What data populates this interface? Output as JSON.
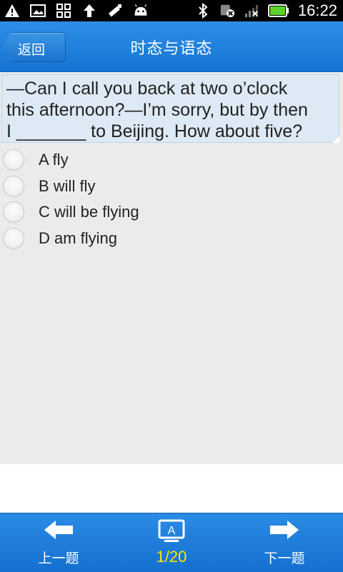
{
  "statusbar": {
    "time": "16:22",
    "left_icons": [
      "warning-icon",
      "picture-icon",
      "apps-icon",
      "upload-icon",
      "usb-icon",
      "android-icon"
    ],
    "right_icons": [
      "bluetooth-icon",
      "sync-icon",
      "signal-icon",
      "battery-icon"
    ]
  },
  "header": {
    "back_label": "返回",
    "title": "时态与语态"
  },
  "question": {
    "text_line1": "—Can I call you back at two o’clock",
    "text_line2": "this afternoon?—I’m sorry, but by then",
    "text_line3": "I _______ to Beijing. How about five?"
  },
  "options": [
    {
      "label": "A fly"
    },
    {
      "label": "B will fly"
    },
    {
      "label": "C will be flying"
    },
    {
      "label": "D am flying"
    }
  ],
  "bottom_nav": {
    "prev_label": "上一题",
    "counter": "1/20",
    "next_label": "下一题",
    "answer_icon_letter": "A"
  },
  "colors": {
    "accent_blue": "#1574d2",
    "counter_yellow": "#ffe600",
    "question_bg": "#dde9f4"
  }
}
